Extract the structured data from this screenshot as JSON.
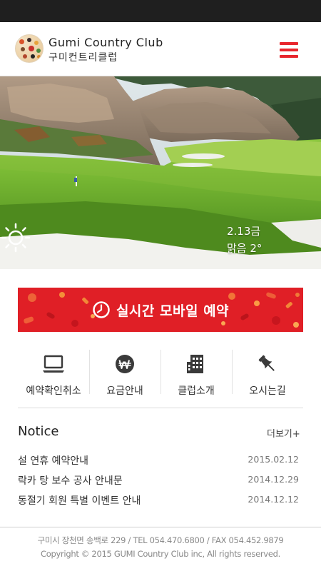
{
  "header": {
    "brand_en": "Gumi Country Club",
    "brand_ko": "구미컨트리클럽",
    "logo_icon": "logo-icon",
    "menu_icon": "hamburger-menu-icon"
  },
  "hero": {
    "weather": {
      "date": "2.13금",
      "description": "맑음 2°",
      "icon": "sun-icon"
    }
  },
  "banner": {
    "label": "실시간 모바일 예약",
    "icon": "clock-icon",
    "color": "#e01f26"
  },
  "quick_menu": [
    {
      "label": "예약확인취소",
      "icon": "laptop-icon"
    },
    {
      "label": "요금안내",
      "icon": "won-icon"
    },
    {
      "label": "클럽소개",
      "icon": "building-icon"
    },
    {
      "label": "오시는길",
      "icon": "pushpin-icon"
    }
  ],
  "notice": {
    "title": "Notice",
    "more": "더보기+",
    "items": [
      {
        "title": "설 연휴 예약안내",
        "date": "2015.02.12"
      },
      {
        "title": "락카 탕 보수 공사 안내문",
        "date": "2014.12.29"
      },
      {
        "title": "동절기 회원 특별 이벤트 안내",
        "date": "2014.12.12"
      }
    ]
  },
  "footer": {
    "address": "구미시 장천면 송백로 229 / TEL 054.470.6800 / FAX 054.452.9879",
    "copyright": "Copyright © 2015 GUMI Country Club inc, All rights reserved."
  },
  "colors": {
    "accent": "#e8262d",
    "banner": "#e01f26"
  }
}
